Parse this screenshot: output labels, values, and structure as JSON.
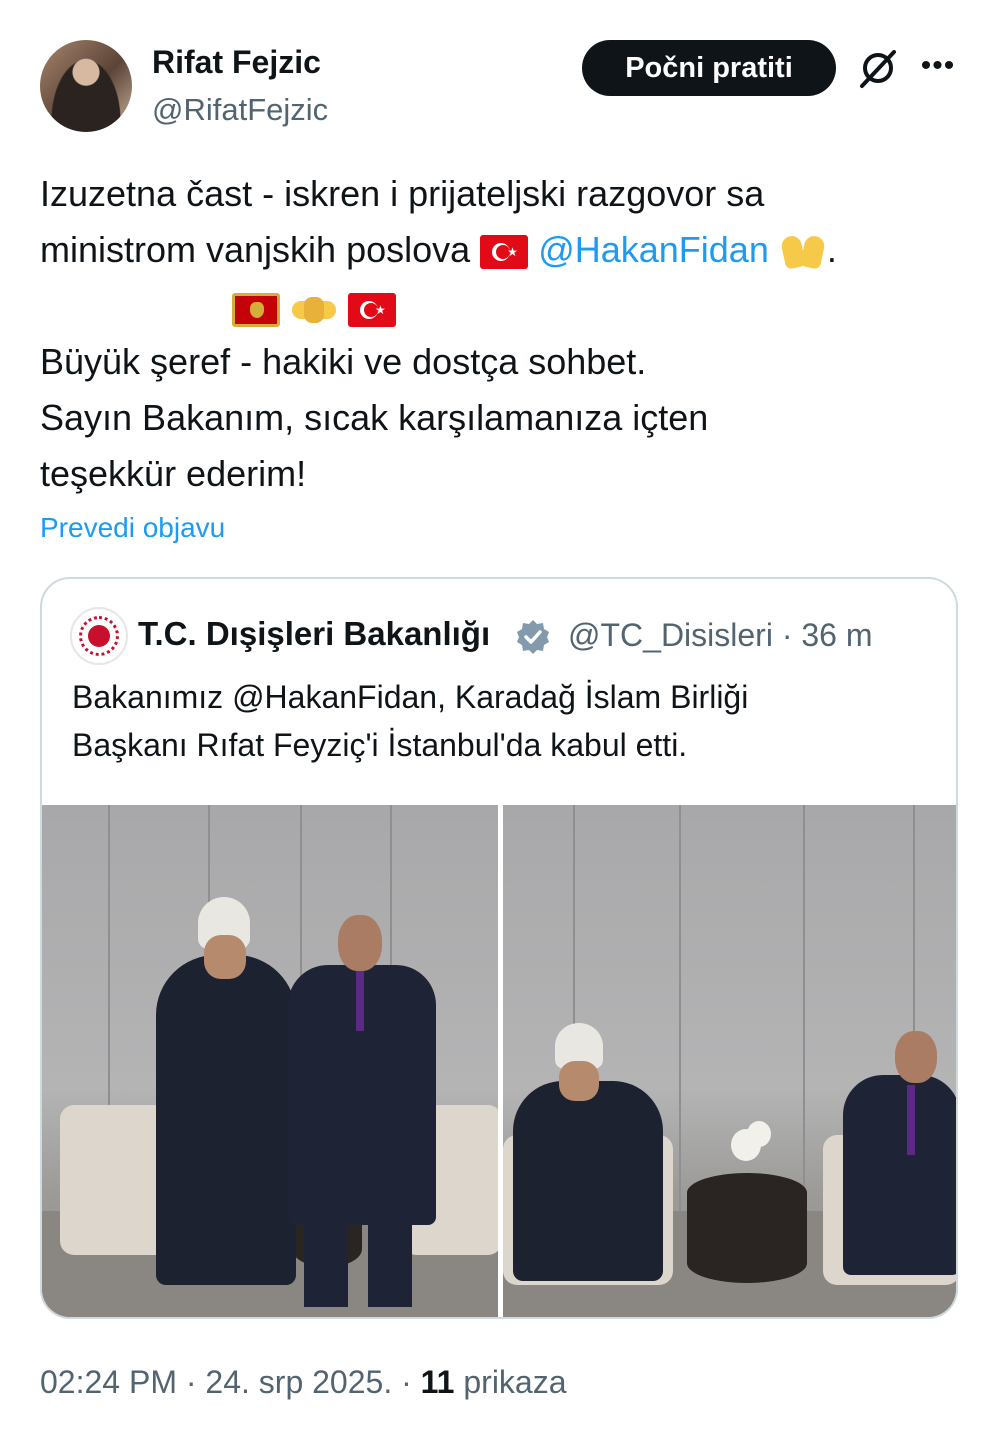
{
  "author": {
    "name": "Rifat Fejzic",
    "handle": "@RifatFejzic",
    "follow_label": "Počni pratiti"
  },
  "post": {
    "line1": "Izuzetna čast - iskren i prijateljski razgovor sa",
    "line2_text": "ministrom vanjskih poslova",
    "line2_mention": "@HakanFidan",
    "line2_end": ".",
    "line4": "Büyük şeref - hakiki ve dostça sohbet.",
    "line5": "Sayın Bakanım, sıcak  karşılamanıza içten",
    "line6": "teşekkür ederim!",
    "translate_label": "Prevedi objavu",
    "emojis": [
      "turkey-flag",
      "raising-hands",
      "montenegro-flag",
      "handshake",
      "turkey-flag"
    ]
  },
  "quote": {
    "name": "T.C. Dışişleri Bakanlığı",
    "handle": "@TC_Disisleri",
    "time": "36 m",
    "meta": "@TC_Disisleri · 36 m",
    "line1": "Bakanımız @HakanFidan, Karadağ İslam Birliği",
    "line2": "Başkanı Rıfat Feyziç'i İstanbul'da kabul etti."
  },
  "footer": {
    "time": "02:24 PM · 24. srp 2025. · ",
    "views_count": "11",
    "views_label": " prikaza"
  },
  "colors": {
    "text": "#0f1419",
    "secondary": "#536471",
    "link": "#1d9bf0",
    "border": "#cfd9de"
  }
}
